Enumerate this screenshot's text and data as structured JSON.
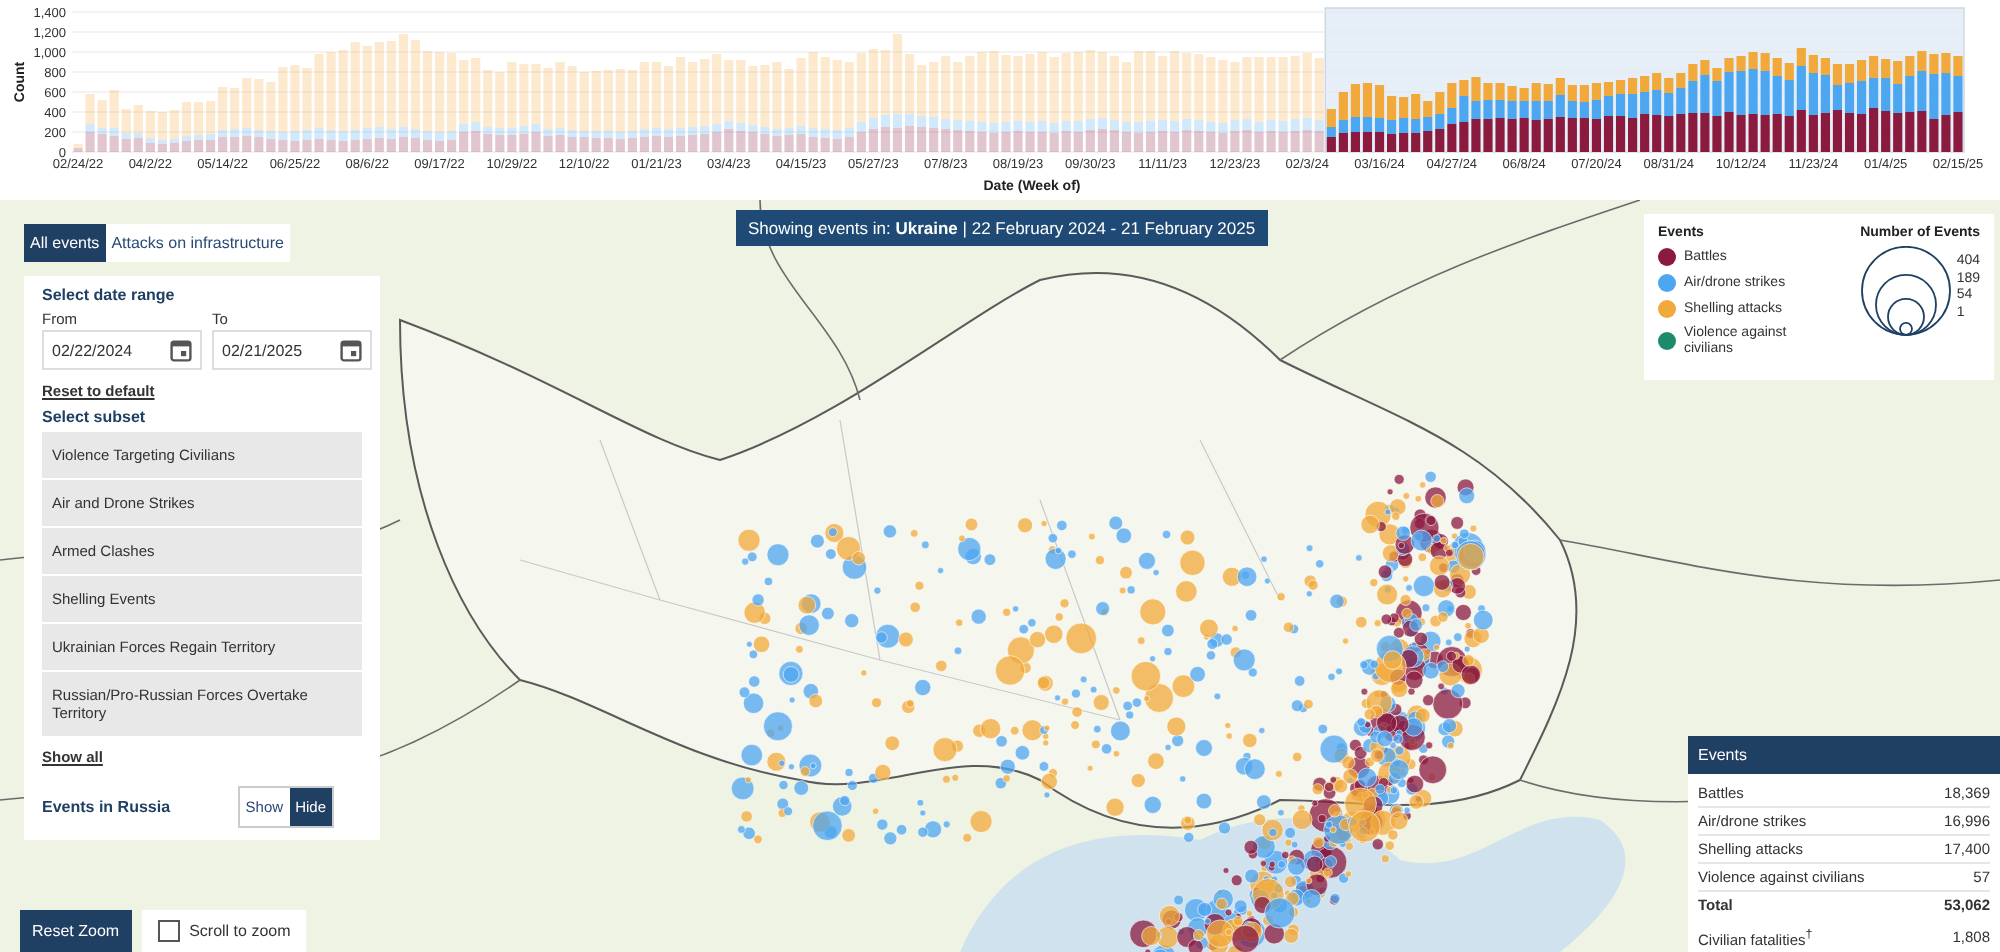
{
  "chart": {
    "chart_data": {
      "type": "bar",
      "stacked": true,
      "xlabel": "Date (Week of)",
      "ylabel": "Count",
      "ylim": [
        0,
        1400
      ],
      "yticks": [
        {
          "value": 0,
          "label": "0"
        },
        {
          "value": 200,
          "label": "200"
        },
        {
          "value": 400,
          "label": "400"
        },
        {
          "value": 600,
          "label": "600"
        },
        {
          "value": 800,
          "label": "800"
        },
        {
          "value": 1000,
          "label": "1,000"
        },
        {
          "value": 1200,
          "label": "1,200"
        },
        {
          "value": 1400,
          "label": "1,400"
        }
      ],
      "grid": true,
      "categories": [
        "02/24/22",
        null,
        null,
        null,
        null,
        null,
        "04/2/22",
        null,
        null,
        null,
        null,
        null,
        "05/14/22",
        null,
        null,
        null,
        null,
        null,
        "06/25/22",
        null,
        null,
        null,
        null,
        null,
        "08/6/22",
        null,
        null,
        null,
        null,
        null,
        "09/17/22",
        null,
        null,
        null,
        null,
        null,
        "10/29/22",
        null,
        null,
        null,
        null,
        null,
        "12/10/22",
        null,
        null,
        null,
        null,
        null,
        "01/21/23",
        null,
        null,
        null,
        null,
        null,
        "03/4/23",
        null,
        null,
        null,
        null,
        null,
        "04/15/23",
        null,
        null,
        null,
        null,
        null,
        "05/27/23",
        null,
        null,
        null,
        null,
        null,
        "07/8/23",
        null,
        null,
        null,
        null,
        null,
        "08/19/23",
        null,
        null,
        null,
        null,
        null,
        "09/30/23",
        null,
        null,
        null,
        null,
        null,
        "11/11/23",
        null,
        null,
        null,
        null,
        null,
        "12/23/23",
        null,
        null,
        null,
        null,
        null,
        "02/3/24",
        null,
        null,
        null,
        null,
        null,
        "03/16/24",
        null,
        null,
        null,
        null,
        null,
        "04/27/24",
        null,
        null,
        null,
        null,
        null,
        "06/8/24",
        null,
        null,
        null,
        null,
        null,
        "07/20/24",
        null,
        null,
        null,
        null,
        null,
        "08/31/24",
        null,
        null,
        null,
        null,
        null,
        "10/12/24",
        null,
        null,
        null,
        null,
        null,
        "11/23/24",
        null,
        null,
        null,
        null,
        null,
        "01/4/25",
        null,
        null,
        null,
        null,
        null,
        "02/15/25"
      ],
      "series": [
        {
          "color": "#8b1a3f",
          "values": [
            40,
            200,
            180,
            160,
            130,
            140,
            90,
            80,
            90,
            110,
            120,
            120,
            150,
            150,
            160,
            150,
            130,
            120,
            110,
            120,
            130,
            120,
            110,
            120,
            130,
            140,
            130,
            150,
            140,
            120,
            110,
            120,
            200,
            210,
            180,
            170,
            170,
            180,
            200,
            160,
            170,
            150,
            150,
            140,
            140,
            130,
            140,
            150,
            160,
            150,
            160,
            170,
            180,
            200,
            230,
            210,
            200,
            180,
            160,
            170,
            180,
            150,
            140,
            130,
            150,
            200,
            230,
            250,
            240,
            260,
            250,
            240,
            230,
            220,
            210,
            200,
            190,
            200,
            210,
            200,
            200,
            190,
            210,
            200,
            220,
            230,
            220,
            200,
            190,
            200,
            210,
            200,
            220,
            210,
            200,
            190,
            210,
            220,
            200,
            210,
            200,
            210,
            220,
            210,
            150,
            190,
            200,
            200,
            200,
            180,
            190,
            190,
            210,
            230,
            280,
            300,
            330,
            330,
            340,
            330,
            340,
            320,
            330,
            350,
            340,
            340,
            330,
            360,
            360,
            340,
            380,
            370,
            360,
            380,
            390,
            390,
            360,
            400,
            370,
            380,
            370,
            380,
            360,
            420,
            370,
            390,
            420,
            390,
            380,
            440,
            410,
            390,
            400,
            410,
            330,
            370,
            400
          ]
        },
        {
          "color": "#4da6f0",
          "values": [
            0,
            80,
            60,
            80,
            60,
            50,
            50,
            40,
            40,
            50,
            50,
            60,
            70,
            80,
            80,
            70,
            80,
            80,
            100,
            100,
            110,
            100,
            100,
            100,
            110,
            110,
            100,
            100,
            90,
            90,
            90,
            90,
            80,
            90,
            70,
            70,
            70,
            80,
            80,
            70,
            70,
            70,
            60,
            70,
            70,
            70,
            70,
            80,
            80,
            80,
            80,
            80,
            80,
            80,
            80,
            80,
            70,
            70,
            70,
            70,
            80,
            90,
            90,
            90,
            90,
            100,
            110,
            120,
            140,
            120,
            110,
            110,
            100,
            100,
            100,
            100,
            100,
            100,
            100,
            100,
            110,
            100,
            100,
            110,
            110,
            110,
            100,
            100,
            110,
            110,
            110,
            110,
            110,
            110,
            100,
            100,
            110,
            110,
            100,
            110,
            110,
            120,
            120,
            110,
            100,
            130,
            150,
            150,
            140,
            140,
            150,
            140,
            140,
            150,
            160,
            260,
            180,
            190,
            180,
            180,
            170,
            190,
            180,
            220,
            170,
            160,
            190,
            200,
            220,
            240,
            220,
            250,
            230,
            260,
            320,
            380,
            350,
            400,
            440,
            450,
            440,
            380,
            360,
            440,
            420,
            380,
            250,
            300,
            330,
            300,
            330,
            290,
            360,
            400,
            450,
            420,
            360
          ]
        },
        {
          "color": "#f2a93b",
          "values": [
            40,
            300,
            280,
            380,
            240,
            280,
            270,
            280,
            290,
            340,
            330,
            330,
            430,
            410,
            500,
            510,
            490,
            650,
            660,
            620,
            740,
            780,
            810,
            880,
            820,
            850,
            880,
            930,
            890,
            800,
            800,
            780,
            640,
            640,
            570,
            560,
            660,
            620,
            600,
            610,
            660,
            640,
            590,
            600,
            610,
            630,
            610,
            670,
            660,
            630,
            710,
            650,
            670,
            700,
            610,
            630,
            590,
            620,
            670,
            590,
            680,
            760,
            720,
            700,
            660,
            690,
            690,
            650,
            800,
            600,
            510,
            550,
            630,
            580,
            650,
            700,
            720,
            670,
            650,
            680,
            690,
            660,
            680,
            690,
            690,
            660,
            640,
            600,
            710,
            700,
            640,
            700,
            660,
            660,
            650,
            630,
            580,
            620,
            650,
            630,
            640,
            630,
            650,
            620,
            180,
            280,
            330,
            340,
            330,
            240,
            210,
            250,
            160,
            220,
            250,
            160,
            240,
            170,
            170,
            150,
            130,
            180,
            170,
            170,
            160,
            170,
            170,
            140,
            140,
            160,
            160,
            170,
            150,
            150,
            170,
            150,
            130,
            140,
            150,
            170,
            180,
            180,
            170,
            180,
            180,
            170,
            210,
            190,
            210,
            220,
            190,
            230,
            200,
            200,
            200,
            200,
            200
          ]
        }
      ]
    }
  },
  "map": {
    "tabs": [
      {
        "label": "All events",
        "selected": true
      },
      {
        "label": "Attacks on infrastructure",
        "selected": false
      }
    ],
    "banner": "Showing events in: **Ukraine** | 22 February 2024 - 21 February 2025",
    "filter_panel": {
      "date_range_title": "Select date range",
      "from": {
        "label": "From",
        "value": "02/22/2024"
      },
      "to": {
        "label": "To",
        "value": "02/21/2025"
      },
      "reset_link": "Reset to default",
      "subset_title": "Select subset",
      "subsets": [
        "Violence Targeting Civilians",
        "Air and Drone Strikes",
        "Armed Clashes",
        "Shelling Events",
        "Ukrainian Forces Regain Territory",
        "Russian/Pro-Russian Forces Overtake Territory"
      ],
      "show_all_link": "Show all",
      "russia_toggle": {
        "label": "Events in Russia",
        "options": [
          {
            "label": "Show",
            "selected": false
          },
          {
            "label": "Hide",
            "selected": true
          }
        ]
      }
    },
    "legend": {
      "title": "Events",
      "items": [
        {
          "label": "Battles",
          "color": "#8b1a3f"
        },
        {
          "label": "Air/drone strikes",
          "color": "#4da6f0"
        },
        {
          "label": "Shelling attacks",
          "color": "#f2a93b"
        },
        {
          "label": "Violence against civilians",
          "color": "#1d8a6b"
        }
      ],
      "size_title": "Number of Events",
      "sizes": [
        "404",
        "189",
        "54",
        "1"
      ]
    },
    "summary_table": {
      "title": "Events",
      "rows": [
        {
          "kind": "count",
          "label": "Battles",
          "value": "18,369"
        },
        {
          "kind": "count",
          "label": "Air/drone strikes",
          "value": "16,996"
        },
        {
          "kind": "count",
          "label": "Shelling attacks",
          "value": "17,400"
        },
        {
          "kind": "count",
          "label": "Violence against civilians",
          "value": "57"
        },
        {
          "kind": "total",
          "label": "Total",
          "value": "53,062"
        },
        {
          "kind": "note",
          "label": "Civilian fatalities$^{†}$",
          "value": "1,808"
        }
      ]
    },
    "reset_zoom_button": "Reset Zoom",
    "scroll_to_zoom": {
      "label": "Scroll to zoom",
      "checked": false
    }
  }
}
